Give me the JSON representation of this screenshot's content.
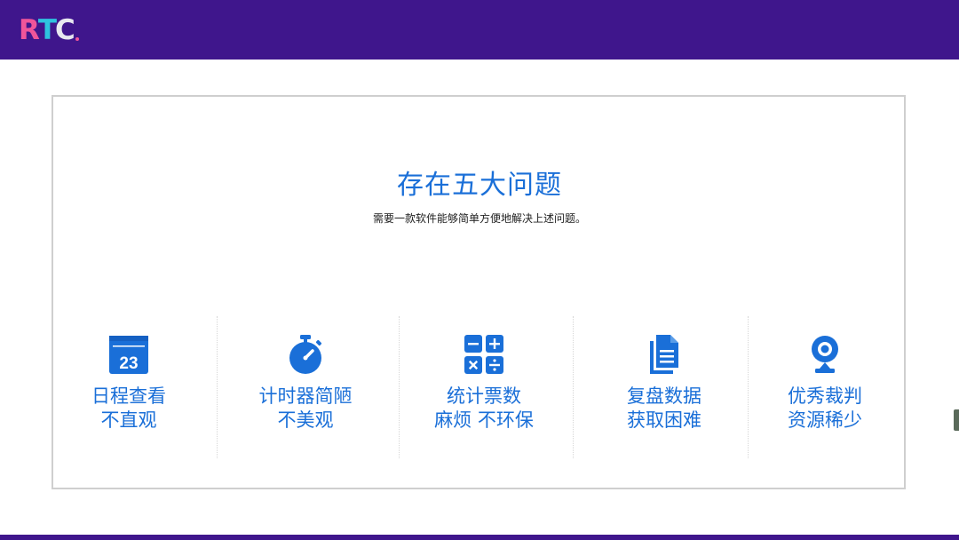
{
  "header": {
    "logo_text": "RTC",
    "bar_color": "#3f168c"
  },
  "main": {
    "title": "存在五大问题",
    "subtitle": "需要一款软件能够简单方便地解决上述问题。",
    "accent_color": "#1a6fd8",
    "problems": [
      {
        "icon": "calendar-icon",
        "calendar_day": "23",
        "line1": "日程查看",
        "line2": "不直观"
      },
      {
        "icon": "stopwatch-icon",
        "line1": "计时器简陋",
        "line2": "不美观"
      },
      {
        "icon": "calculator-icon",
        "line1": "统计票数",
        "line2": "麻烦 不环保"
      },
      {
        "icon": "document-icon",
        "line1": "复盘数据",
        "line2": "获取困难"
      },
      {
        "icon": "webcam-icon",
        "line1": "优秀裁判",
        "line2": "资源稀少"
      }
    ]
  }
}
